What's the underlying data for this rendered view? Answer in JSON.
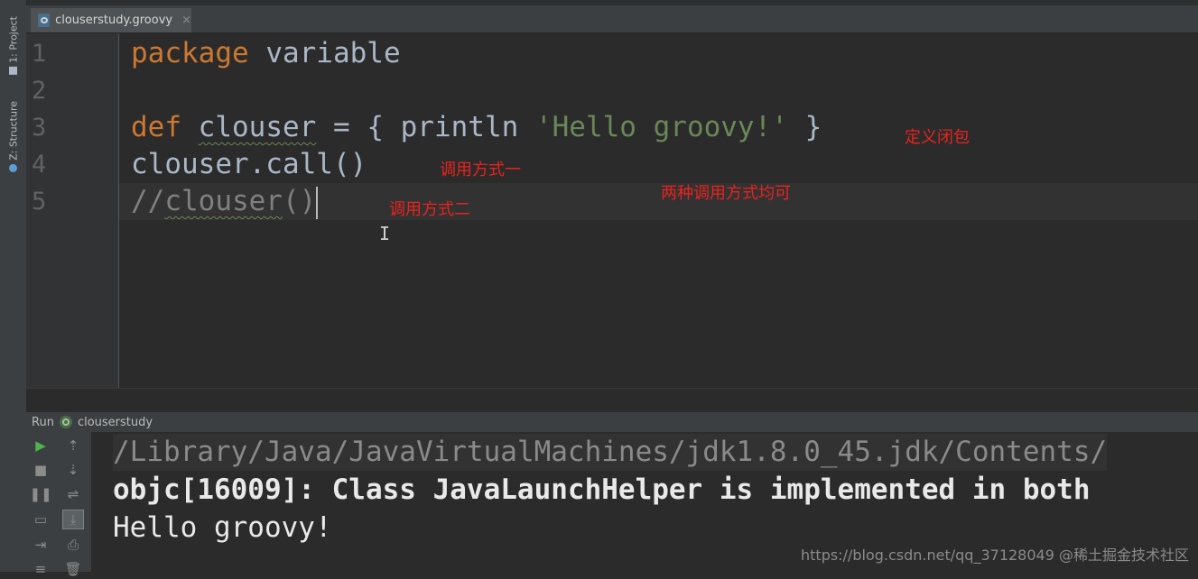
{
  "side_tabs": {
    "project": "1: Project",
    "structure": "Z: Structure"
  },
  "editor_tab": {
    "label": "clouserstudy.groovy",
    "close": "×"
  },
  "code": {
    "line_numbers": [
      "1",
      "2",
      "3",
      "4",
      "5"
    ],
    "line1": {
      "keyword": "package",
      "rest": " variable"
    },
    "line3": {
      "keyword": "def",
      "name": "clouser",
      "mid": " = { println ",
      "string": "'Hello groovy!'",
      "end": " }"
    },
    "line4": {
      "text": "clouser.call()"
    },
    "line5": {
      "prefix": "//",
      "name": "clouser",
      "suffix": "()"
    }
  },
  "annotations": {
    "define": "定义闭包",
    "call_one": "调用方式一",
    "call_two": "调用方式二",
    "both_ok": "两种调用方式均可"
  },
  "run_panel": {
    "label": "Run",
    "config": "clouserstudy",
    "console_lines": [
      "/Library/Java/JavaVirtualMachines/jdk1.8.0_45.jdk/Contents/",
      "objc[16009]: Class JavaLaunchHelper is implemented in both",
      "Hello groovy!"
    ]
  },
  "watermark": "https://blog.csdn.net/qq_37128049  @稀土掘金技术社区"
}
